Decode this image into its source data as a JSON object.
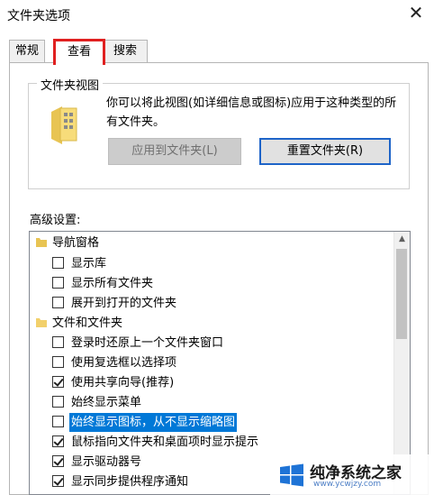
{
  "window": {
    "title": "文件夹选项"
  },
  "tabs": [
    {
      "label": "常规",
      "active": false
    },
    {
      "label": "查看",
      "active": true
    },
    {
      "label": "搜索",
      "active": false
    }
  ],
  "folder_view": {
    "group_label": "文件夹视图",
    "description": "你可以将此视图(如详细信息或图标)应用于这种类型的所有文件夹。",
    "apply_button": "应用到文件夹(L)",
    "reset_button": "重置文件夹(R)"
  },
  "advanced": {
    "label": "高级设置:",
    "items": [
      {
        "type": "folder",
        "label": "导航窗格"
      },
      {
        "type": "checkbox",
        "label": "显示库",
        "checked": false
      },
      {
        "type": "checkbox",
        "label": "显示所有文件夹",
        "checked": false
      },
      {
        "type": "checkbox",
        "label": "展开到打开的文件夹",
        "checked": false
      },
      {
        "type": "folder",
        "label": "文件和文件夹"
      },
      {
        "type": "checkbox",
        "label": "登录时还原上一个文件夹窗口",
        "checked": false
      },
      {
        "type": "checkbox",
        "label": "使用复选框以选择项",
        "checked": false
      },
      {
        "type": "checkbox",
        "label": "使用共享向导(推荐)",
        "checked": true
      },
      {
        "type": "checkbox",
        "label": "始终显示菜单",
        "checked": false
      },
      {
        "type": "checkbox",
        "label": "始终显示图标，从不显示缩略图",
        "checked": false,
        "selected": true
      },
      {
        "type": "checkbox",
        "label": "鼠标指向文件夹和桌面项时显示提示",
        "checked": true
      },
      {
        "type": "checkbox",
        "label": "显示驱动器号",
        "checked": true
      },
      {
        "type": "checkbox",
        "label": "显示同步提供程序通知",
        "checked": true
      }
    ]
  },
  "watermark": {
    "text": "纯净系统之家",
    "url": "www.ycwjzy.com"
  },
  "colors": {
    "selection": "#0078d7",
    "tab_highlight": "#e02020",
    "primary_border": "#1e64c8"
  }
}
